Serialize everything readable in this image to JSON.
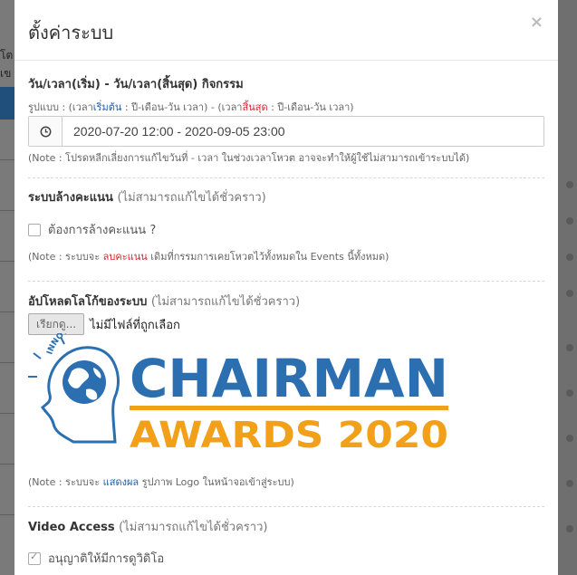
{
  "modal": {
    "title": "ตั้งค่าระบบ",
    "close_label": "×"
  },
  "activity_time": {
    "title": "วัน/เวลา(เริ่ม) - วัน/เวลา(สิ้นสุด) กิจกรรม",
    "format_prefix": "รูปแบบ : (เวลา",
    "format_start_word": "เริ่มต้น",
    "format_mid": " : ปี-เดือน-วัน เวลา) - (เวลา",
    "format_end_word": "สิ้นสุด",
    "format_suffix": " : ปี-เดือน-วัน เวลา)",
    "value": "2020-07-20 12:00 - 2020-09-05 23:00",
    "note": "(Note : โปรดหลีกเลี่ยงการแก้ไขวันที่ - เวลา ในช่วงเวลาโหวต อาจจะทำให้ผู้ใช้ไม่สามารถเข้าระบบได้)"
  },
  "clear_scores": {
    "title": "ระบบล้างคะแนน",
    "title_muted": "(ไม่สามารถแก้ไขได้ชั่วคราว)",
    "checkbox_label": "ต้องการล้างคะแนน ?",
    "checked": false,
    "note_prefix": "(Note : ระบบจะ ",
    "note_highlight": "ลบคะแนน",
    "note_suffix": " เดิมที่กรรมการเคยโหวตไว้ทั้งหมดใน Events นี้ทั้งหมด)"
  },
  "upload_logo": {
    "title": "อัปโหลดโลโก้ของระบบ",
    "title_muted": "(ไม่สามารถแก้ไขได้ชั่วคราว)",
    "browse_label": "เรียกดู...",
    "no_file_text": "ไม่มีไฟล์ที่ถูกเลือก",
    "logo_arc_text": "INNOVATION",
    "logo_line1": "CHAIRMAN",
    "logo_line2": "AWARDS 2020",
    "note_prefix": "(Note : ระบบจะ ",
    "note_highlight": "แสดงผล",
    "note_suffix": " รูปภาพ Logo ในหน้าจอเข้าสู่ระบบ)"
  },
  "video_access": {
    "title": "Video Access",
    "title_muted": "(ไม่สามารถแก้ไขได้ชั่วคราว)",
    "checkbox_label": "อนุญาติให้มีการดูวิดิโอ",
    "checked": true
  },
  "background": {
    "left_fragments": [
      "โต",
      "เข"
    ]
  },
  "colors": {
    "logo_blue": "#2b6fb1",
    "logo_orange": "#f2a019",
    "note_blue": "#1f5fa8",
    "note_red": "#d9262f"
  }
}
